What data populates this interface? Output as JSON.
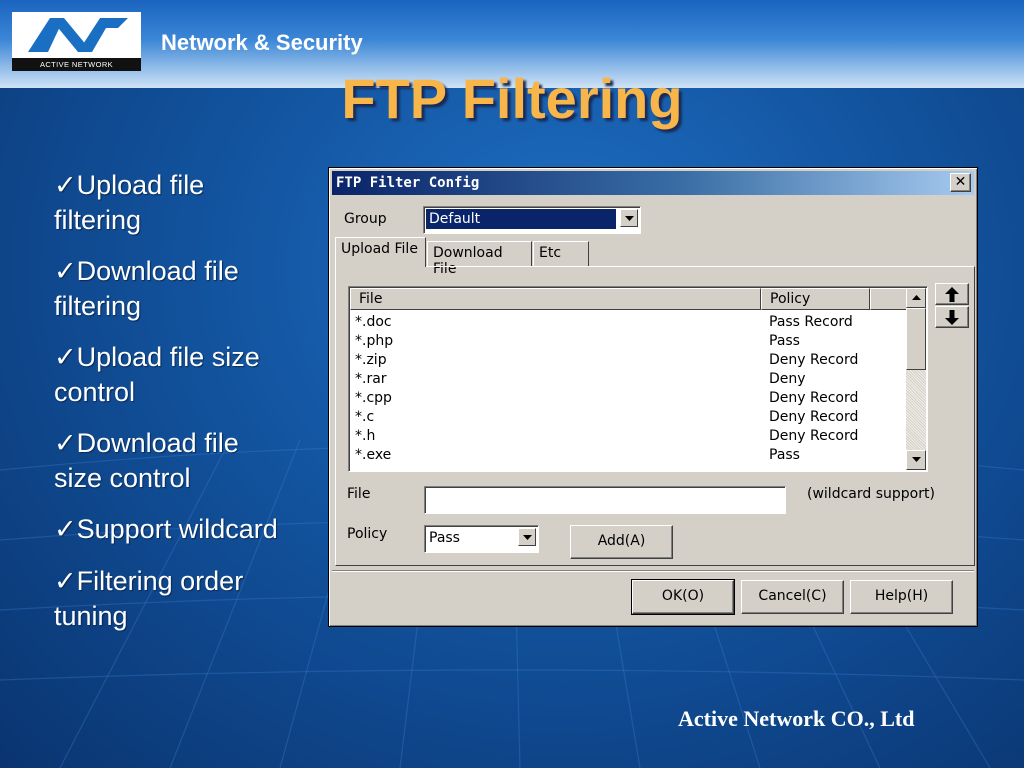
{
  "slide": {
    "brand": "Network & Security",
    "logo_text": "ACTIVE NETWORK",
    "title": "FTP Filtering",
    "check_mark": "✓",
    "bullets": [
      "Upload file filtering",
      "Download file filtering",
      "Upload file size control",
      "Download file size control",
      "Support wildcard",
      "Filtering order tuning"
    ],
    "footer": "Active Network CO., Ltd"
  },
  "dialog": {
    "title": "FTP Filter Config",
    "close_label": "✕",
    "group_label": "Group",
    "group_value": "Default",
    "tabs": [
      "Upload File",
      "Download File",
      "Etc"
    ],
    "active_tab": "Upload File",
    "list": {
      "columns": [
        "File",
        "Policy"
      ],
      "rows": [
        {
          "file": "*.doc",
          "policy": "Pass Record"
        },
        {
          "file": "*.php",
          "policy": "Pass"
        },
        {
          "file": "*.zip",
          "policy": "Deny Record"
        },
        {
          "file": "*.rar",
          "policy": "Deny"
        },
        {
          "file": "*.cpp",
          "policy": "Deny Record"
        },
        {
          "file": "*.c",
          "policy": "Deny Record"
        },
        {
          "file": "*.h",
          "policy": "Deny Record"
        },
        {
          "file": "*.exe",
          "policy": "Pass"
        }
      ]
    },
    "file_label": "File",
    "file_value": "",
    "wildcard_note": "(wildcard support)",
    "policy_label": "Policy",
    "policy_value": "Pass",
    "add_button": "Add(A)",
    "ok_button": "OK(O)",
    "cancel_button": "Cancel(C)",
    "help_button": "Help(H)",
    "move_up_icon": "arrow-up-icon",
    "move_down_icon": "arrow-down-icon"
  },
  "colors": {
    "title_orange": "#f7b54a",
    "background_blue": "#12539e",
    "titlebar_dark": "#0a246a",
    "dialog_face": "#d4d0c8"
  }
}
